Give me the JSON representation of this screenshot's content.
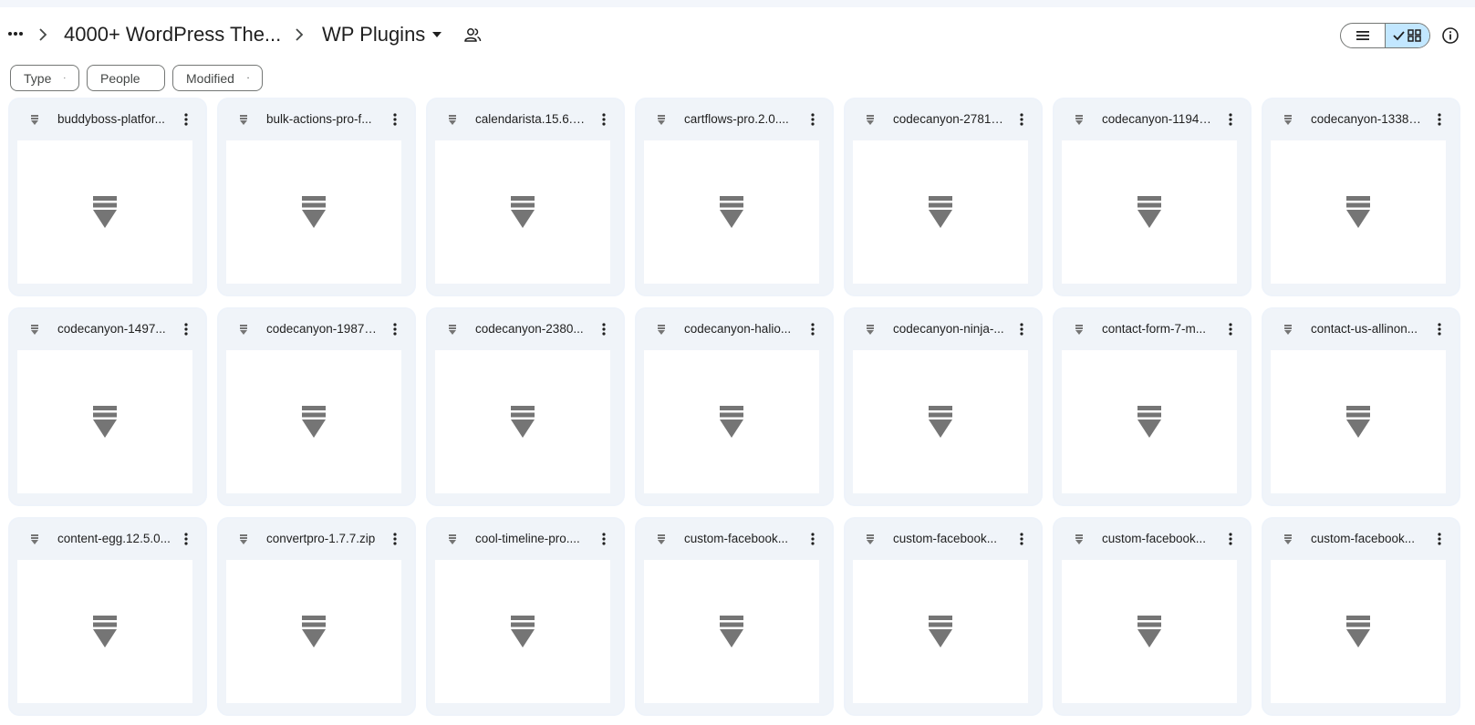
{
  "breadcrumb": {
    "more_icon": "more-horiz-icon",
    "parent": "4000+ WordPress The...",
    "current": "WP Plugins",
    "shared_icon": "shared-people-icon"
  },
  "view_toggle": {
    "list_icon": "list-view-icon",
    "grid_icon": "grid-view-icon",
    "active": "grid"
  },
  "info_icon": "info-icon",
  "filters": [
    {
      "label": "Type"
    },
    {
      "label": "People"
    },
    {
      "label": "Modified"
    }
  ],
  "colors": {
    "active_toggle_bg": "#c2e7ff",
    "card_bg": "#f0f4f9",
    "icon_gray": "#757575"
  },
  "files": [
    {
      "name": "buddyboss-platfor...",
      "icon": "zip-file-icon"
    },
    {
      "name": "bulk-actions-pro-f...",
      "icon": "zip-file-icon"
    },
    {
      "name": "calendarista.15.6.4....",
      "icon": "zip-file-icon"
    },
    {
      "name": "cartflows-pro.2.0....",
      "icon": "zip-file-icon"
    },
    {
      "name": "codecanyon-27813...",
      "icon": "zip-file-icon"
    },
    {
      "name": "codecanyon-11943...",
      "icon": "zip-file-icon"
    },
    {
      "name": "codecanyon-13388...",
      "icon": "zip-file-icon"
    },
    {
      "name": "codecanyon-1497...",
      "icon": "zip-file-icon"
    },
    {
      "name": "codecanyon-19878...",
      "icon": "zip-file-icon"
    },
    {
      "name": "codecanyon-2380...",
      "icon": "zip-file-icon"
    },
    {
      "name": "codecanyon-halio...",
      "icon": "zip-file-icon"
    },
    {
      "name": "codecanyon-ninja-...",
      "icon": "zip-file-icon"
    },
    {
      "name": "contact-form-7-m...",
      "icon": "zip-file-icon"
    },
    {
      "name": "contact-us-allinon...",
      "icon": "zip-file-icon"
    },
    {
      "name": "content-egg.12.5.0...",
      "icon": "zip-file-icon"
    },
    {
      "name": "convertpro-1.7.7.zip",
      "icon": "zip-file-icon"
    },
    {
      "name": "cool-timeline-pro....",
      "icon": "zip-file-icon"
    },
    {
      "name": "custom-facebook...",
      "icon": "zip-file-icon"
    },
    {
      "name": "custom-facebook...",
      "icon": "zip-file-icon"
    },
    {
      "name": "custom-facebook...",
      "icon": "zip-file-icon"
    },
    {
      "name": "custom-facebook...",
      "icon": "zip-file-icon"
    }
  ]
}
